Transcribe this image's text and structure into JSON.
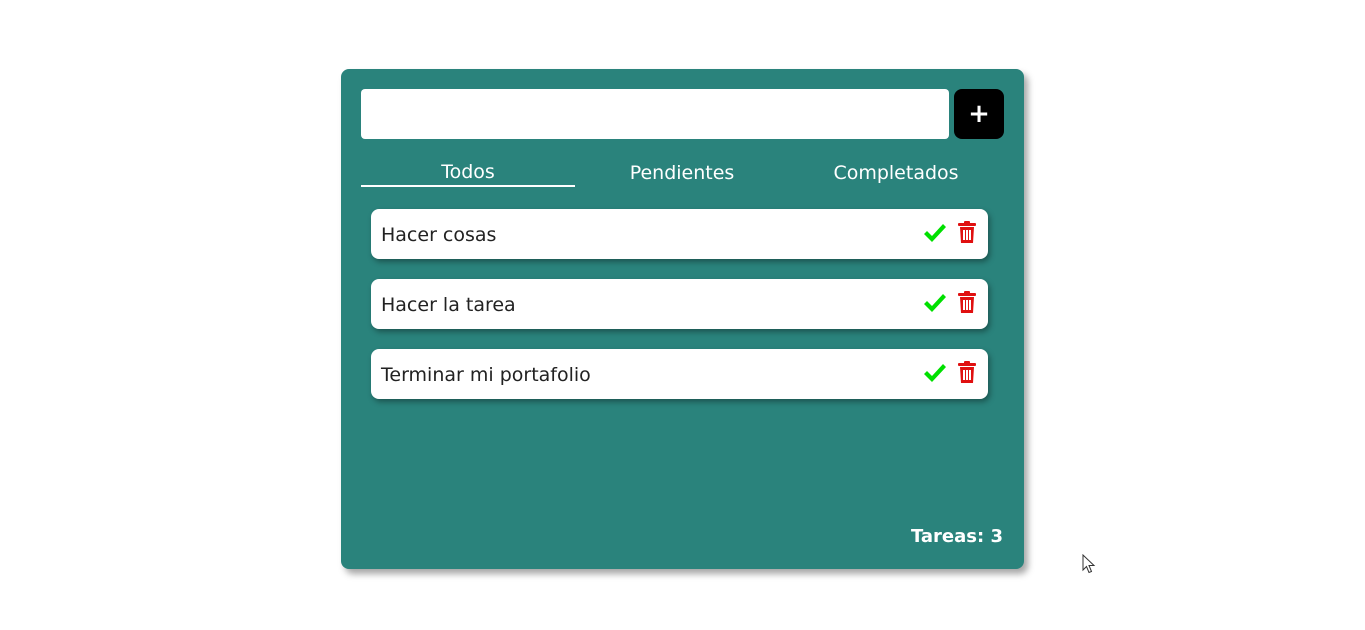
{
  "input": {
    "value": "",
    "placeholder": ""
  },
  "add_button": {
    "label": "+"
  },
  "tabs": [
    {
      "label": "Todos",
      "active": true
    },
    {
      "label": "Pendientes",
      "active": false
    },
    {
      "label": "Completados",
      "active": false
    }
  ],
  "tasks": [
    {
      "text": "Hacer cosas"
    },
    {
      "text": "Hacer la tarea"
    },
    {
      "text": "Terminar mi portafolio"
    }
  ],
  "counter": {
    "text": "Tareas: 3"
  },
  "colors": {
    "card_background": "#2a837c",
    "add_button": "#000000",
    "check": "#00e000",
    "trash": "#e01010"
  },
  "icons": {
    "complete": "check-icon",
    "delete": "trash-icon",
    "cursor": "mouse-pointer-icon"
  }
}
